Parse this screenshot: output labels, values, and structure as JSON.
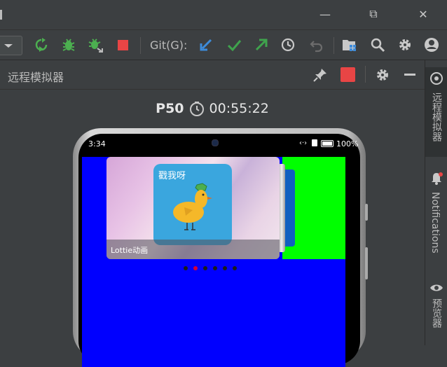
{
  "window": {
    "minimize_glyph": "—",
    "restore_glyph": "⧉",
    "close_glyph": "✕"
  },
  "toolbar": {
    "git_label": "Git(G):"
  },
  "panel": {
    "title": "远程模拟器"
  },
  "device": {
    "name": "P50",
    "session_time": "00:55:22"
  },
  "phone": {
    "status_time": "3:34",
    "battery": "100%",
    "tile_text": "戳我呀",
    "caption": "Lottie动画",
    "dots_count": 6,
    "active_dot_index": 1
  },
  "side_tabs": {
    "emulator": "远程模拟器",
    "notifications": "Notifications",
    "previewer": "预览器"
  },
  "colors": {
    "accent_red": "#e84545",
    "git_blue": "#3d8bd9",
    "git_green": "#3fa34d",
    "screen_blue": "#0000ff",
    "screen_green": "#00ff00"
  }
}
